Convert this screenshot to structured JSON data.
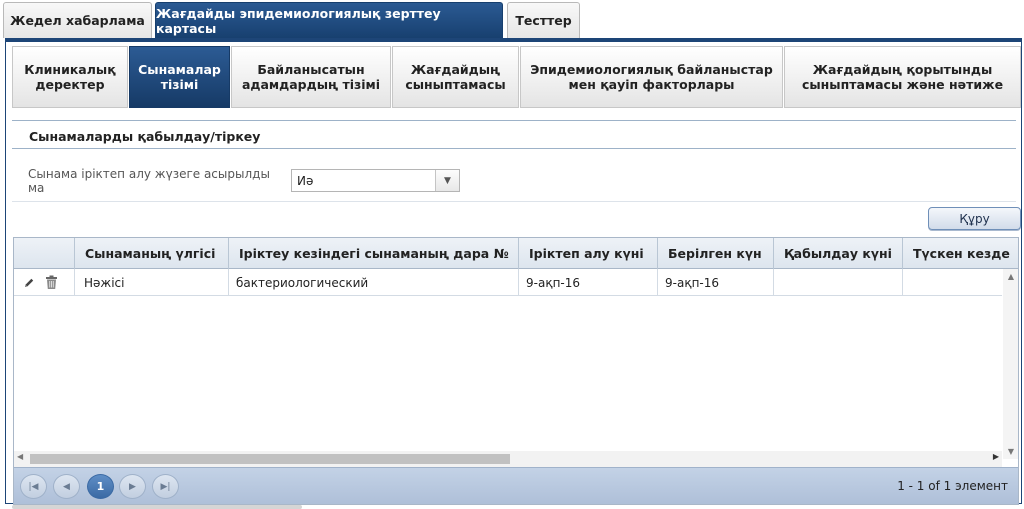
{
  "top_tabs": [
    {
      "label": "Жедел хабарлама",
      "active": false
    },
    {
      "label": "Жағдайды эпидемиологиялық зерттеу картасы",
      "active": true
    },
    {
      "label": "Тесттер",
      "active": false
    }
  ],
  "sub_tabs": [
    {
      "line1": "Клиникалық",
      "line2": "деректер",
      "active": false
    },
    {
      "line1": "Сынамалар",
      "line2": "тізімі",
      "active": true
    },
    {
      "line1": "Байланысатын",
      "line2": "адамдардың тізімі",
      "active": false
    },
    {
      "line1": "Жағдайдың",
      "line2": "сыныптамасы",
      "active": false
    },
    {
      "line1": "Эпидемиологиялық байланыстар",
      "line2": "мен қауіп факторлары",
      "active": false
    },
    {
      "line1": "Жағдайдың қорытынды",
      "line2": "сыныптамасы және нәтиже",
      "active": false
    }
  ],
  "section_title": "Сынамаларды қабылдау/тіркеу",
  "sampling_field": {
    "label": "Сынама іріктеп алу жүзеге асырылды ма",
    "value": "Иә"
  },
  "create_button": "Құру",
  "grid": {
    "columns": [
      "",
      "Сынаманың үлгісі",
      "Іріктеу кезіндегі сынаманың дара №",
      "Іріктеп алу күні",
      "Берілген күн",
      "Қабылдау күні",
      "Түскен кезде"
    ],
    "rows": [
      {
        "sample_type": "Нәжісі",
        "sample_number": "бактериологический",
        "sampling_date": "9-ақп-16",
        "issued_date": "9-ақп-16",
        "received_date": "",
        "arrival": ""
      }
    ]
  },
  "pager": {
    "current_page": "1",
    "info": "1 - 1 of 1 элемент"
  }
}
